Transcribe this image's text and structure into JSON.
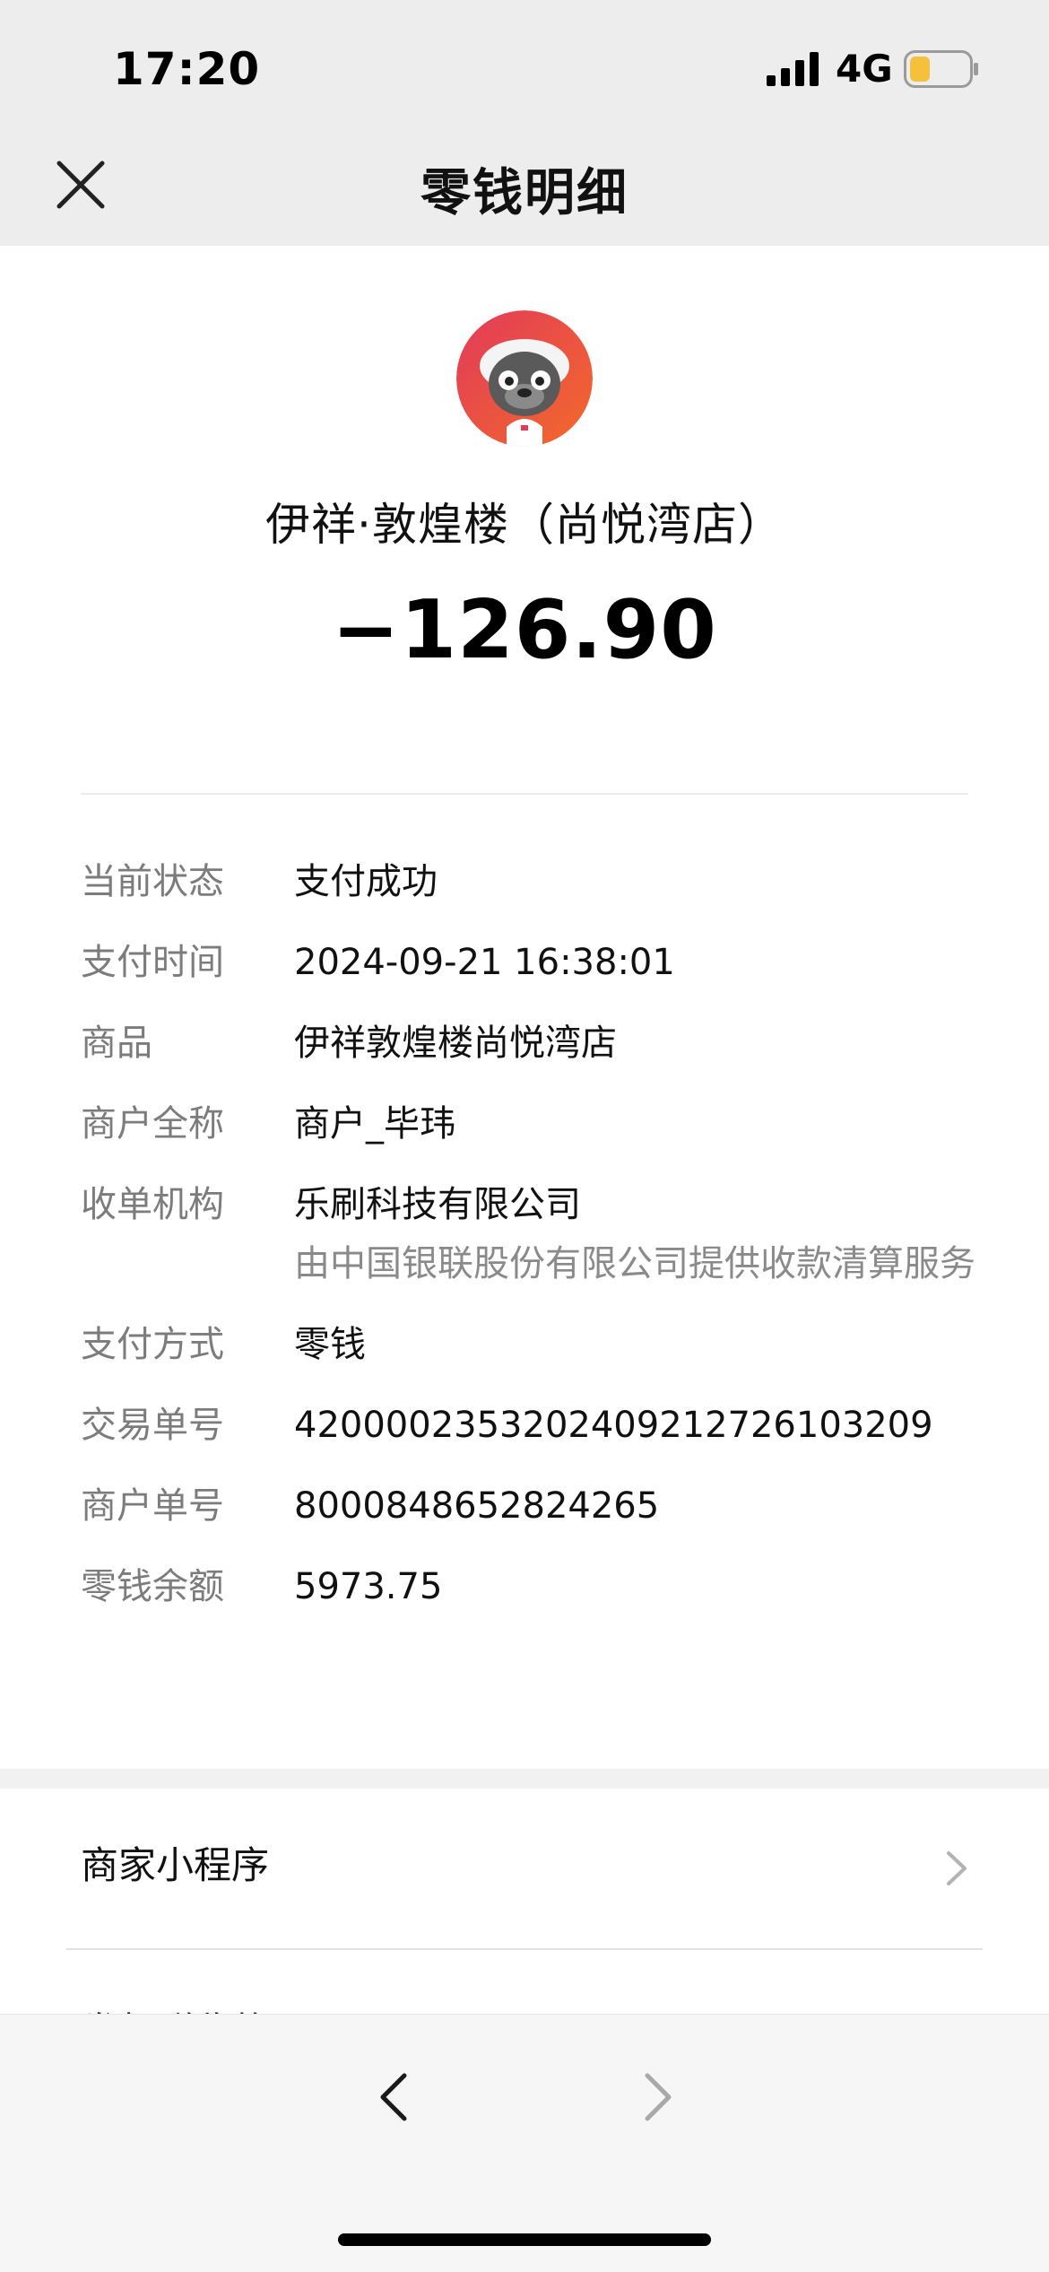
{
  "status_bar": {
    "time": "17:20",
    "network": "4G",
    "signal_icon": "cellular-signal-icon",
    "battery_icon": "battery-icon",
    "battery_level": 0.35,
    "battery_color": "#f5c13b"
  },
  "header": {
    "title": "零钱明细",
    "close_icon": "close-icon"
  },
  "merchant": {
    "avatar_icon": "merchant-avatar",
    "name": "伊祥·敦煌楼（尚悦湾店）",
    "amount": "−126.90"
  },
  "details": [
    {
      "label": "当前状态",
      "value": "支付成功"
    },
    {
      "label": "支付时间",
      "value": "2024-09-21 16:38:01"
    },
    {
      "label": "商品",
      "value": "伊祥敦煌楼尚悦湾店"
    },
    {
      "label": "商户全称",
      "value": "商户_毕玮"
    },
    {
      "label": "收单机构",
      "value": "乐刷科技有限公司",
      "note": "由中国银联股份有限公司提供收款清算服务"
    },
    {
      "label": "支付方式",
      "value": "零钱"
    },
    {
      "label": "交易单号",
      "value": "4200002353202409212726103209"
    },
    {
      "label": "商户单号",
      "value": "8000848652824265"
    },
    {
      "label": "零钱余额",
      "value": "5973.75"
    }
  ],
  "actions": {
    "mini_program": "商家小程序",
    "partial_row": "发起群收款"
  },
  "browser_nav": {
    "back_icon": "chevron-left-icon",
    "forward_icon": "chevron-right-icon"
  }
}
